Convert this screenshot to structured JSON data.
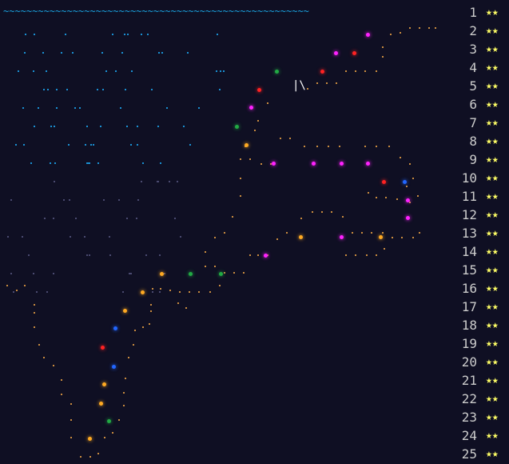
{
  "calendar": {
    "wave_text": "~~~~~~~~~~~~~~~~~~~~~~~~~~~~~~~~~~~~~~~~~~~~~~~~~~~~~",
    "days": [
      {
        "num": "1",
        "stars": "★★"
      },
      {
        "num": "2",
        "stars": "★★"
      },
      {
        "num": "3",
        "stars": "★★"
      },
      {
        "num": "4",
        "stars": "★★"
      },
      {
        "num": "5",
        "stars": "★★"
      },
      {
        "num": "6",
        "stars": "★★"
      },
      {
        "num": "7",
        "stars": "★★"
      },
      {
        "num": "8",
        "stars": "★★"
      },
      {
        "num": "9",
        "stars": "★★"
      },
      {
        "num": "10",
        "stars": "★★"
      },
      {
        "num": "11",
        "stars": "★★"
      },
      {
        "num": "12",
        "stars": "★★"
      },
      {
        "num": "13",
        "stars": "★★"
      },
      {
        "num": "14",
        "stars": "★★"
      },
      {
        "num": "15",
        "stars": "★★"
      },
      {
        "num": "16",
        "stars": "★★"
      },
      {
        "num": "17",
        "stars": "★★"
      },
      {
        "num": "18",
        "stars": "★★"
      },
      {
        "num": "19",
        "stars": "★★"
      },
      {
        "num": "20",
        "stars": "★★"
      },
      {
        "num": "21",
        "stars": "★★"
      },
      {
        "num": "22",
        "stars": "★★"
      },
      {
        "num": "23",
        "stars": "★★"
      },
      {
        "num": "24",
        "stars": "★★"
      },
      {
        "num": "25",
        "stars": "★★"
      }
    ],
    "lighthouse_glyph": "|\\",
    "colors": {
      "background": "#0f0f23",
      "wave": "#1aa3e0",
      "coast": "#c88a3e",
      "star": "#ffff66",
      "number": "#cccccc"
    }
  }
}
